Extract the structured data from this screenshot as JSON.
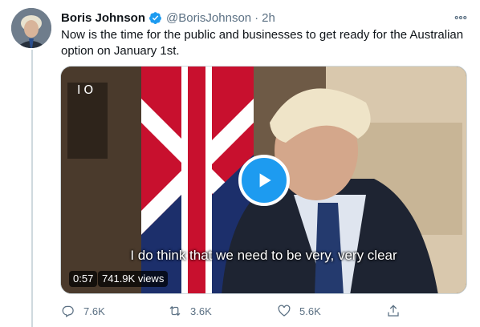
{
  "tweet": {
    "author_name": "Boris Johnson",
    "handle": "@BorisJohnson",
    "separator": "·",
    "timestamp": "2h",
    "text": "Now is the time for the public and businesses to get ready for the Australian option on January 1st.",
    "icons": [
      "avatar",
      "verified-badge-icon",
      "more-options-icon"
    ]
  },
  "media": {
    "corner_logo": "IO",
    "subtitle": "I do think that we need to be very, very clear",
    "duration": "0:57",
    "views": "741.9K views",
    "play_icon": "play-icon"
  },
  "actions": {
    "reply_count": "7.6K",
    "retweet_count": "3.6K",
    "like_count": "5.6K",
    "icons": [
      "reply-icon",
      "retweet-icon",
      "like-icon",
      "share-icon"
    ]
  },
  "colors": {
    "accent": "#1d9bf0",
    "secondary_text": "#5b7083",
    "thread_line": "#cfd9de"
  }
}
